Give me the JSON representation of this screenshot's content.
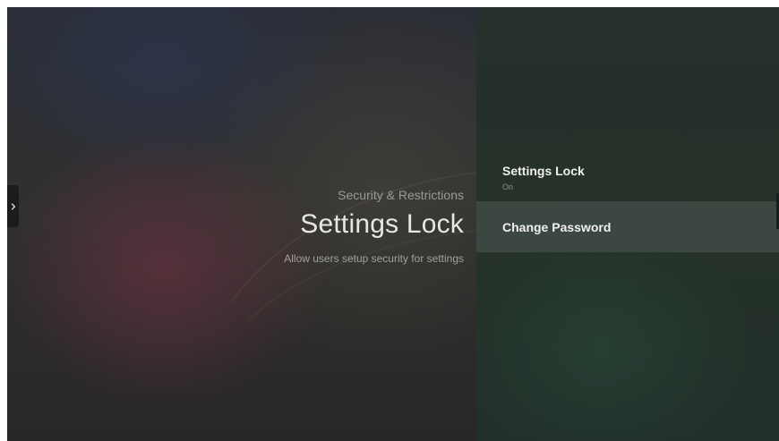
{
  "header": {
    "breadcrumb": "Security & Restrictions",
    "title": "Settings Lock",
    "description": "Allow users setup security for settings"
  },
  "menu": {
    "items": [
      {
        "title": "Settings Lock",
        "subtitle": "On"
      },
      {
        "title": "Change Password"
      }
    ]
  },
  "icons": {
    "expand_tab": "chevron-right-icon"
  },
  "colors": {
    "left_background": "#2e2f33",
    "right_background": "#253129",
    "selected_item": "#3d4741",
    "title_text": "#e6e6e4"
  }
}
